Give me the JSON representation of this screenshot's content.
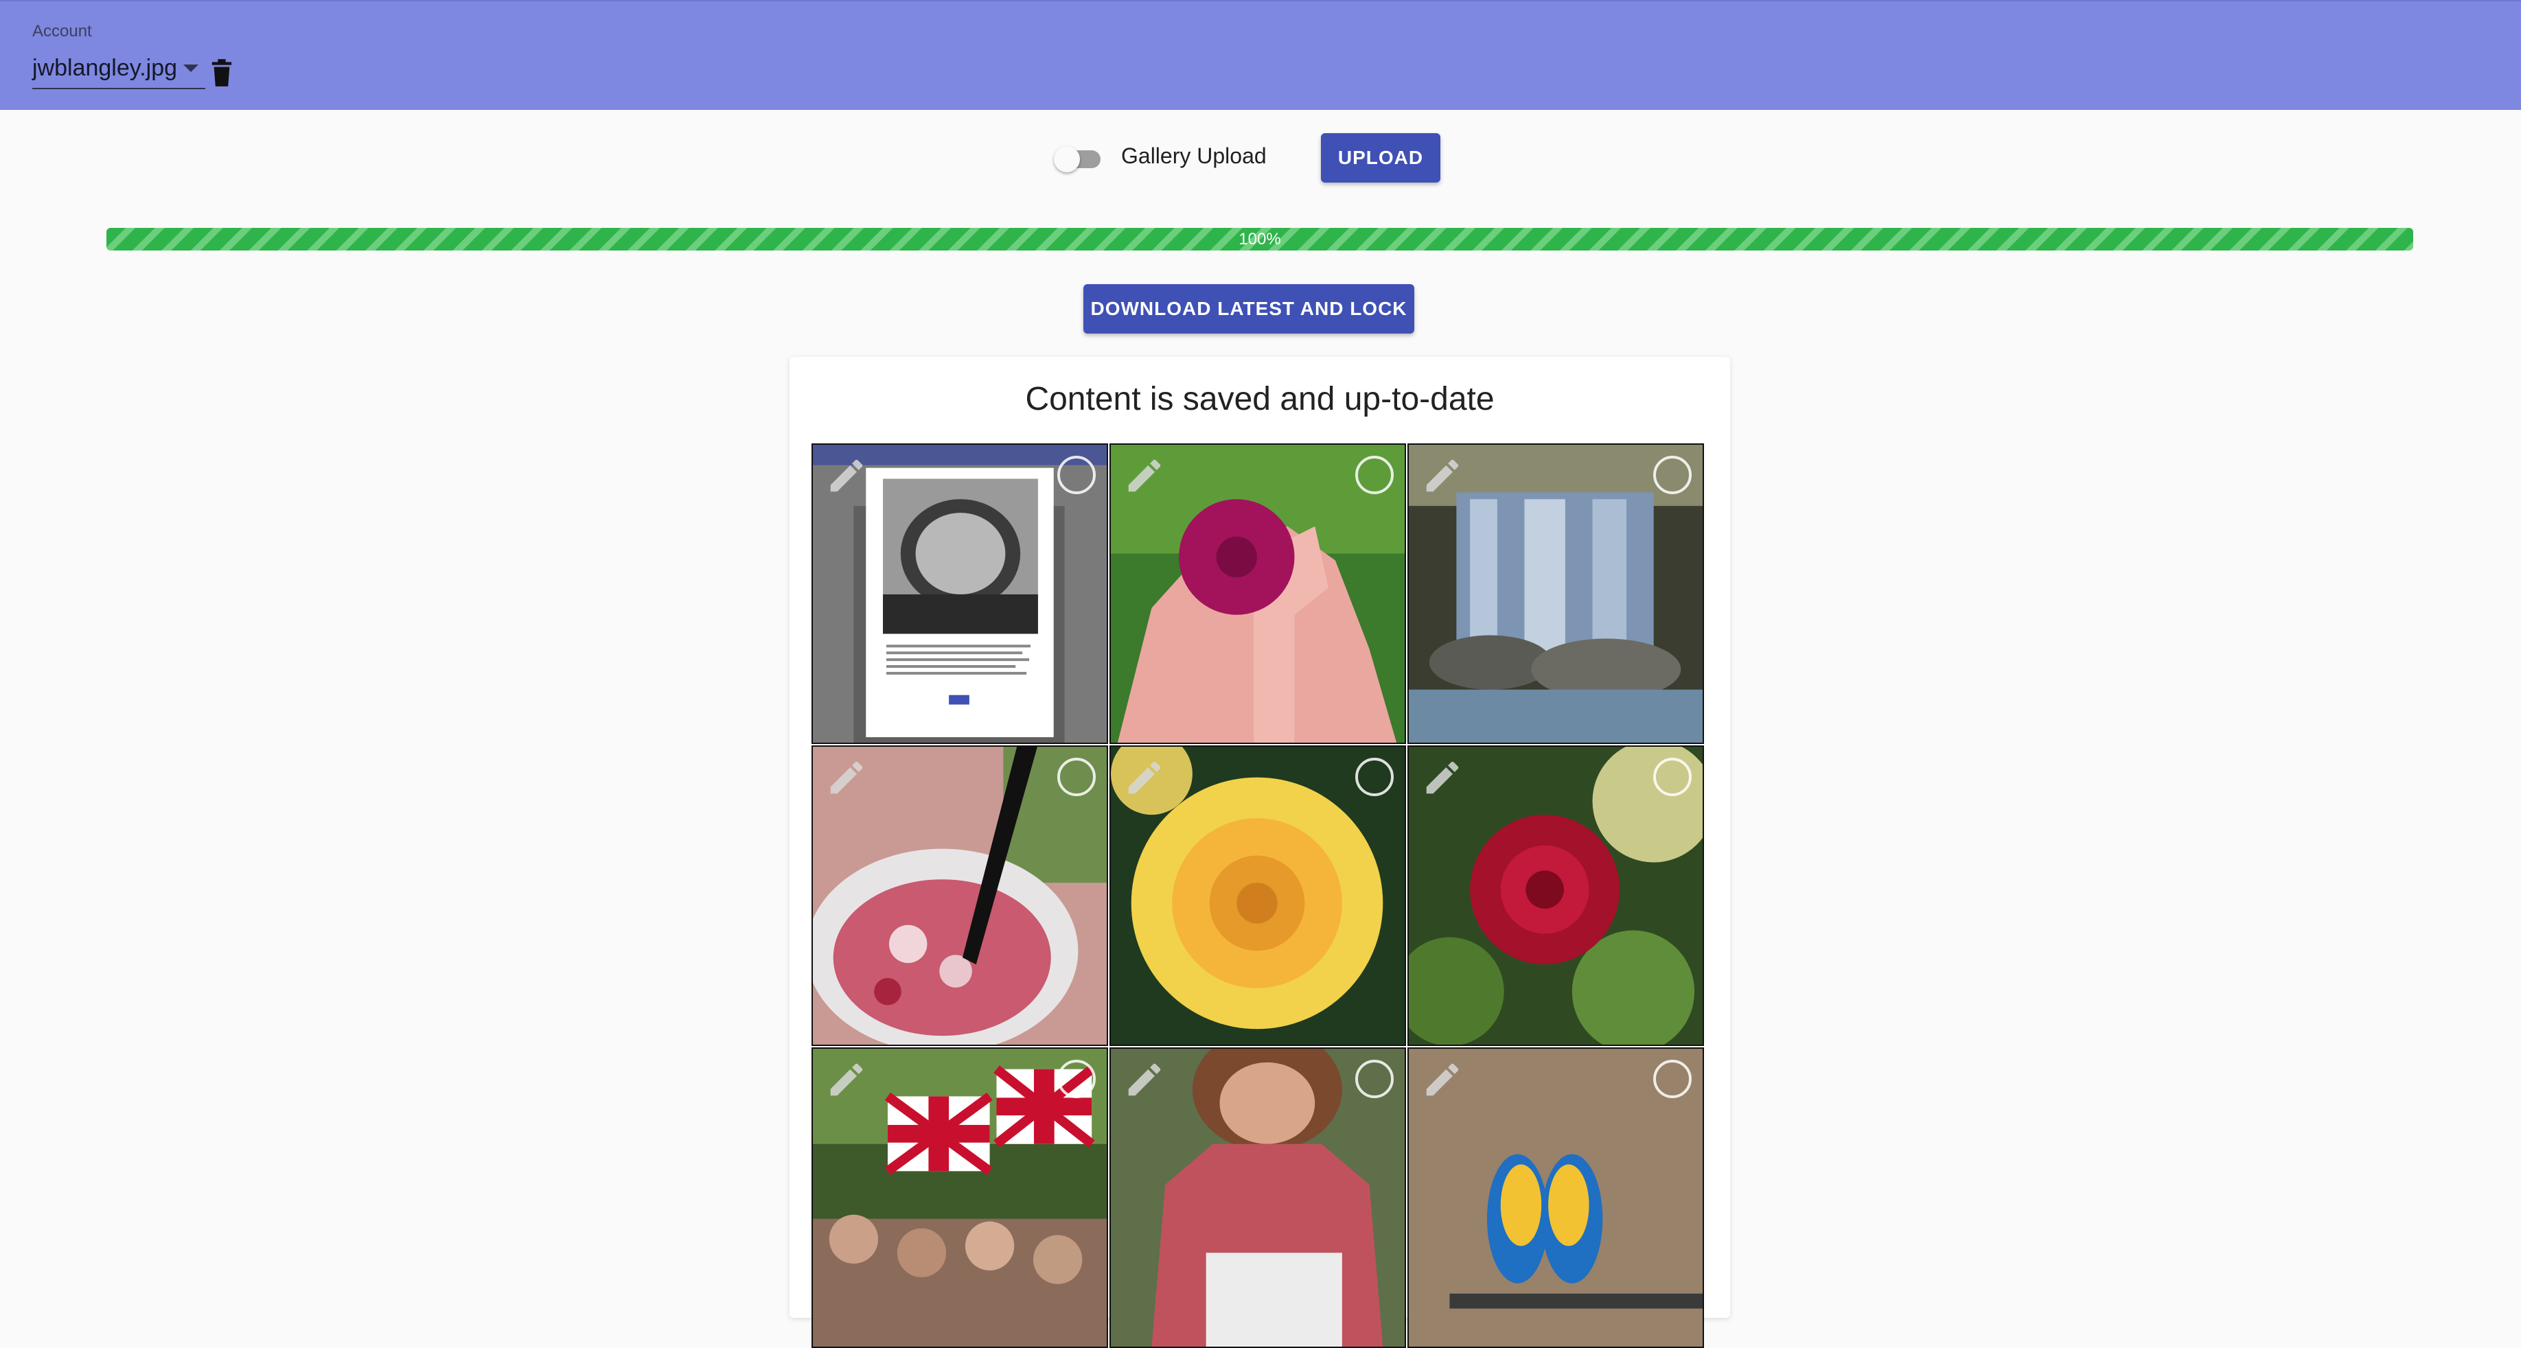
{
  "header": {
    "account_label": "Account",
    "account_value": "jwblangley.jpg",
    "trash_icon": "trash-icon"
  },
  "controls": {
    "toggle_label": "Gallery Upload",
    "toggle_on": false,
    "upload_label": "UPLOAD"
  },
  "progress": {
    "value": 100,
    "text": "100%"
  },
  "download_label": "DOWNLOAD LATEST AND LOCK",
  "content": {
    "status_title": "Content is saved and up-to-date",
    "photos": [
      {
        "subject": "screenshot-of-photo-dialog"
      },
      {
        "subject": "pink-flower-in-hand"
      },
      {
        "subject": "waterfall"
      },
      {
        "subject": "pink-drink-with-straw"
      },
      {
        "subject": "yellow-rose"
      },
      {
        "subject": "red-rose"
      },
      {
        "subject": "union-jack-flags-crowd"
      },
      {
        "subject": "woman-in-pink-top"
      },
      {
        "subject": "blue-yellow-macaws"
      }
    ]
  },
  "colors": {
    "header": "#7e88e0",
    "primary": "#3f51b5",
    "progress": "#2fb44b"
  }
}
